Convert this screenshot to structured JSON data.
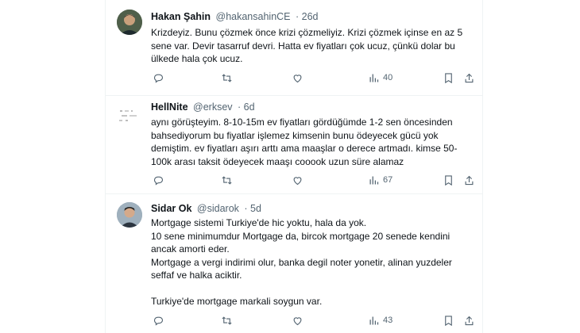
{
  "tweets": [
    {
      "name": "Hakan Şahin",
      "handle": "@hakansahinCE",
      "time": "· 26d",
      "lines": [
        "Krizdeyiz. Bunu çözmek önce krizi çözmeliyiz. Krizi çözmek içinse en az 5",
        "sene var. Devir tasarruf devri. Hatta ev fiyatları çok ucuz, çünkü dolar bu",
        "ülkede hala çok ucuz."
      ],
      "views": "40"
    },
    {
      "name": "HellNite",
      "handle": "@erksev",
      "time": "· 6d",
      "lines": [
        "aynı görüşteyim. 8-10-15m ev fiyatları gördüğümde 1-2 sen öncesinden",
        "bahsediyorum bu fiyatlar işlemez kimsenin bunu ödeyecek gücü yok",
        "demiştim. ev fiyatları aşırı arttı ama maaşlar o derece artmadı. kimse 50-",
        "100k arası taksit ödeyecek maaşı cooook uzun süre alamaz"
      ],
      "views": "67"
    },
    {
      "name": "Sidar Ok",
      "handle": "@sidarok",
      "time": "· 5d",
      "lines": [
        "Mortgage sistemi Turkiye'de hic yoktu, hala da yok.",
        "10 sene minimumdur Mortgage da, bircok mortgage 20 senede kendini",
        "ancak amorti eder.",
        "Mortgage a vergi indirimi olur, banka degil noter yonetir, alinan yuzdeler",
        "seffaf ve halka aciktir.",
        "",
        "Turkiye'de mortgage markali soygun var."
      ],
      "views": "43"
    }
  ],
  "icons": {
    "reply": "reply-icon",
    "retweet": "retweet-icon",
    "like": "like-icon",
    "views": "views-icon",
    "bookmark": "bookmark-icon",
    "share": "share-icon"
  },
  "colors": {
    "text": "#0f1419",
    "muted": "#536471",
    "divider": "#eff3f4"
  }
}
